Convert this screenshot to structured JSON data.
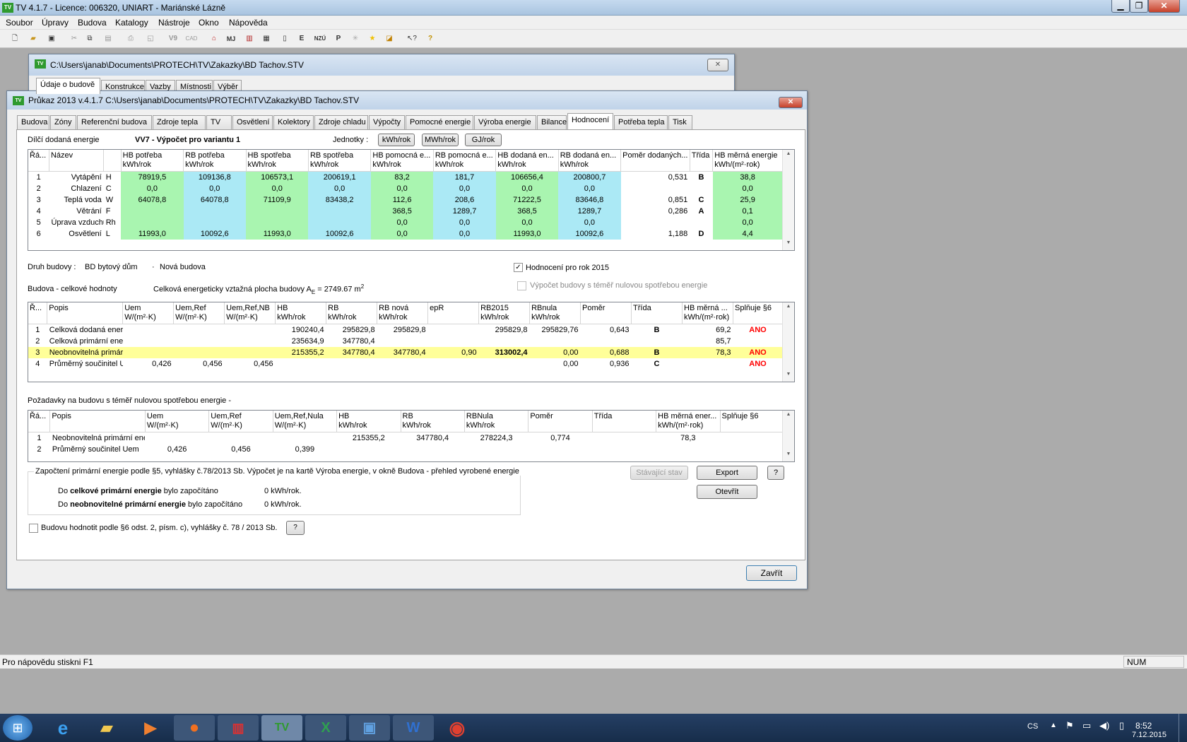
{
  "app": {
    "title": "TV 4.1.7 - Licence: 006320, UNIART - Mariánské Lázně",
    "icon": "tv-app-icon"
  },
  "menu": [
    "Soubor",
    "Úpravy",
    "Budova",
    "Katalogy",
    "Nástroje",
    "Okno",
    "Nápověda"
  ],
  "toolbar": {
    "labels": {
      "v9": "V9",
      "cad": "CAD",
      "mj": "MJ",
      "nzu": "NZÚ",
      "p": "P"
    },
    "icons": [
      "new-icon",
      "open-icon",
      "save-icon",
      "cut-icon",
      "copy-icon",
      "paste-icon",
      "print-icon",
      "preview-icon",
      "v9-icon",
      "cad-icon",
      "home-icon",
      "mj-icon",
      "wall-icon",
      "grid-icon",
      "doc-icon",
      "e-icon",
      "nzu-icon",
      "p-icon",
      "sun-icon",
      "star-icon",
      "export-icon",
      "help-pointer-icon",
      "help-icon"
    ]
  },
  "back_window": {
    "title": "C:\\Users\\janab\\Documents\\PROTECH\\TV\\Zakazky\\BD Tachov.STV",
    "tabs": [
      "Údaje o budově",
      "Konstrukce",
      "Vazby",
      "Místnosti",
      "Výběr"
    ]
  },
  "dialog": {
    "title": "Průkaz 2013  v.4.1.7    C:\\Users\\janab\\Documents\\PROTECH\\TV\\Zakazky\\BD Tachov.STV",
    "tabs": [
      "Budova",
      "Zóny",
      "Referenční budova",
      "Zdroje tepla",
      "TV",
      "Osvětlení",
      "Kolektory",
      "Zdroje chladu",
      "Výpočty",
      "Pomocné energie",
      "Výroba energie",
      "Bilance",
      "Hodnocení",
      "Potřeba tepla",
      "Tisk"
    ],
    "active_tab": "Hodnocení",
    "section1_label": "Dílčí dodaná energie",
    "variant": "VV7 - Výpočet pro variantu 1",
    "units_label": "Jednotky :",
    "unit_buttons": [
      "kWh/rok",
      "MWh/rok",
      "GJ/rok"
    ],
    "table1": {
      "headers": [
        [
          "Řá...",
          ""
        ],
        [
          "Název",
          ""
        ],
        [
          "",
          ""
        ],
        [
          "HB potřeba",
          "kWh/rok"
        ],
        [
          "RB potřeba",
          "kWh/rok"
        ],
        [
          "HB spotřeba",
          "kWh/rok"
        ],
        [
          "RB spotřeba",
          "kWh/rok"
        ],
        [
          "HB pomocná e...",
          "kWh/rok"
        ],
        [
          "RB pomocná e...",
          "kWh/rok"
        ],
        [
          "HB dodaná en...",
          "kWh/rok"
        ],
        [
          "RB dodaná en...",
          "kWh/rok"
        ],
        [
          "Poměr dodaných...",
          ""
        ],
        [
          "Třída",
          ""
        ],
        [
          "HB měrná energie",
          "kWh/(m²·rok)"
        ]
      ],
      "rows": [
        [
          "1",
          "Vytápění",
          "H",
          "78919,5",
          "109136,8",
          "106573,1",
          "200619,1",
          "83,2",
          "181,7",
          "106656,4",
          "200800,7",
          "0,531",
          "B",
          "38,8"
        ],
        [
          "2",
          "Chlazení",
          "C",
          "0,0",
          "0,0",
          "0,0",
          "0,0",
          "0,0",
          "0,0",
          "0,0",
          "0,0",
          "",
          "",
          "0,0"
        ],
        [
          "3",
          "Teplá voda",
          "W",
          "64078,8",
          "64078,8",
          "71109,9",
          "83438,2",
          "112,6",
          "208,6",
          "71222,5",
          "83646,8",
          "0,851",
          "C",
          "25,9"
        ],
        [
          "4",
          "Větrání",
          "F",
          "",
          "",
          "",
          "",
          "368,5",
          "1289,7",
          "368,5",
          "1289,7",
          "0,286",
          "A",
          "0,1"
        ],
        [
          "5",
          "Úprava vzduchu",
          "Rh",
          "",
          "",
          "",
          "",
          "0,0",
          "0,0",
          "0,0",
          "0,0",
          "",
          "",
          "0,0"
        ],
        [
          "6",
          "Osvětlení",
          "L",
          "11993,0",
          "10092,6",
          "11993,0",
          "10092,6",
          "0,0",
          "0,0",
          "11993,0",
          "10092,6",
          "1,188",
          "D",
          "4,4"
        ]
      ]
    },
    "building_type_label": "Druh budovy :",
    "building_type": "BD bytový dům",
    "building_status": "Nová budova",
    "rating_2015": "Hodnocení pro rok 2015",
    "nzeb_calc": "Výpočet budovy s téměř nulovou spotřebou energie",
    "section2_label": "Budova - celkové hodnoty",
    "area_text": "Celková energeticky vztažná plocha budovy A",
    "area_sub": "E",
    "area_value": " = 2749.67 m",
    "area_sup": "2",
    "table2": {
      "headers": [
        [
          "Ř...",
          ""
        ],
        [
          "Popis",
          ""
        ],
        [
          "Uem",
          "W/(m²·K)"
        ],
        [
          "Uem,Ref",
          "W/(m²·K)"
        ],
        [
          "Uem,Ref,NB",
          "W/(m²·K)"
        ],
        [
          "HB",
          "kWh/rok"
        ],
        [
          "RB",
          "kWh/rok"
        ],
        [
          "RB nová",
          "kWh/rok"
        ],
        [
          "epR",
          ""
        ],
        [
          "RB2015",
          "kWh/rok"
        ],
        [
          "RBnula",
          "kWh/rok"
        ],
        [
          "Poměr",
          ""
        ],
        [
          "Třída",
          ""
        ],
        [
          "HB měrná ...",
          "kWh/(m²·rok)"
        ],
        [
          "Splňuje §6",
          ""
        ]
      ],
      "rows": [
        [
          "1",
          "Celková dodaná energie",
          "",
          "",
          "",
          "190240,4",
          "295829,8",
          "295829,8",
          "",
          "295829,8",
          "295829,76",
          "0,643",
          "B",
          "69,2",
          "ANO"
        ],
        [
          "2",
          "Celková primární energie",
          "",
          "",
          "",
          "235634,9",
          "347780,4",
          "",
          "",
          "",
          "",
          "",
          "",
          "85,7",
          ""
        ],
        [
          "3",
          "Neobnovitelná primární energie",
          "",
          "",
          "",
          "215355,2",
          "347780,4",
          "347780,4",
          "0,90",
          "313002,4",
          "0,00",
          "0,688",
          "B",
          "78,3",
          "ANO"
        ],
        [
          "4",
          "Průměrný součinitel Uem",
          "0,426",
          "0,456",
          "0,456",
          "",
          "",
          "",
          "",
          "",
          "0,00",
          "0,936",
          "C",
          "",
          "ANO"
        ]
      ]
    },
    "section3_label": "Požadavky na budovu s téměř nulovou spotřebou energie -",
    "table3": {
      "headers": [
        [
          "Řá...",
          ""
        ],
        [
          "Popis",
          ""
        ],
        [
          "Uem",
          "W/(m²·K)"
        ],
        [
          "Uem,Ref",
          "W/(m²·K)"
        ],
        [
          "Uem,Ref,Nula",
          "W/(m²·K)"
        ],
        [
          "HB",
          "kWh/rok"
        ],
        [
          "RB",
          "kWh/rok"
        ],
        [
          "RBNula",
          "kWh/rok"
        ],
        [
          "Poměr",
          ""
        ],
        [
          "Třída",
          ""
        ],
        [
          "HB měrná ener...",
          "kWh/(m²·rok)"
        ],
        [
          "Splňuje §6",
          ""
        ]
      ],
      "rows": [
        [
          "1",
          "Neobnovitelná primární energie",
          "",
          "",
          "",
          "215355,2",
          "347780,4",
          "278224,3",
          "0,774",
          "",
          "78,3",
          ""
        ],
        [
          "2",
          "Průměrný součinitel Uem",
          "0,426",
          "0,456",
          "0,399",
          "",
          "",
          "",
          "",
          "",
          "",
          ""
        ]
      ]
    },
    "primary_group_title": "Započtení primární energie podle §5, vyhlášky č.78/2013 Sb. Výpočet je na kartě Výroba energie, v okně Budova - přehled vyrobené energie",
    "primary_line1": {
      "pre": "Do ",
      "bold": "celkové primární energie",
      "post": " bylo započítáno",
      "value": "0 kWh/rok."
    },
    "primary_line2": {
      "pre": "Do ",
      "bold": "neobnovitelné primární energie",
      "post": " bylo započítáno",
      "value": "0 kWh/rok."
    },
    "btn_stavajici": "Stávající stav",
    "btn_export": "Export",
    "btn_help": "?",
    "btn_otevrit": "Otevřít",
    "par6_label": "Budovu hodnotit podle §6 odst. 2, písm. c), vyhlášky č. 78 / 2013 Sb.",
    "btn_close": "Zavřít"
  },
  "status": {
    "text": "Pro nápovědu stiskni  F1",
    "num": "NUM"
  },
  "taskbar": {
    "lang": "CS",
    "time": "8:52",
    "date": "7.12.2015"
  },
  "colors": {
    "green_cell": "#a9f5b0",
    "blue_cell": "#abe9f5",
    "highlight_row": "#ffff99",
    "red_text": "#ff0000"
  }
}
